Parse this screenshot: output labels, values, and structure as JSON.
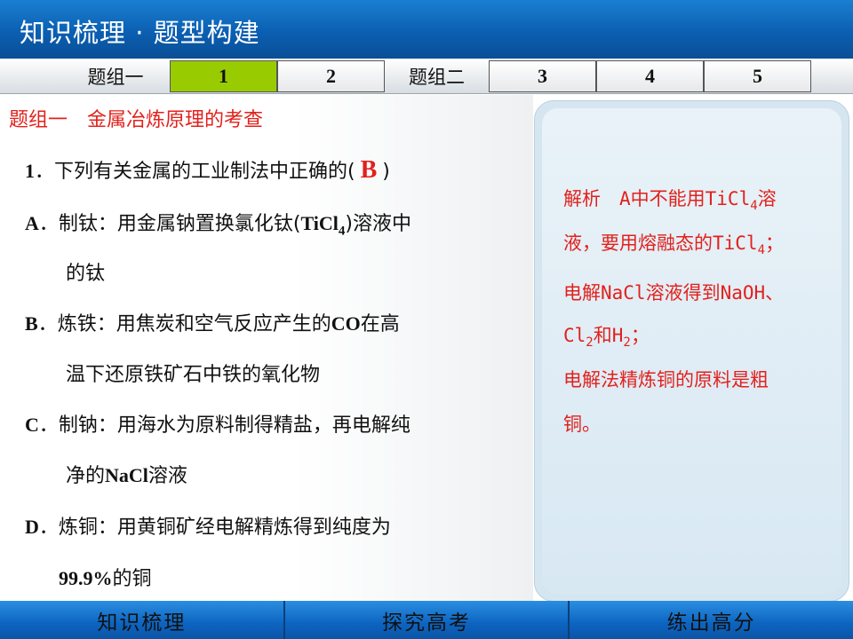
{
  "header": {
    "title": "知识梳理 · 题型构建"
  },
  "tabs": [
    {
      "label": "题组一",
      "kind": "group"
    },
    {
      "label": "1",
      "kind": "tab",
      "active": true
    },
    {
      "label": "2",
      "kind": "tab"
    },
    {
      "label": "题组二",
      "kind": "group"
    },
    {
      "label": "3",
      "kind": "tab"
    },
    {
      "label": "4",
      "kind": "tab"
    },
    {
      "label": "5",
      "kind": "tab"
    }
  ],
  "section": {
    "title": "题组一　金属冶炼原理的考查"
  },
  "question": {
    "stem_prefix": "1",
    "stem_text": "．下列有关金属的工业制法中正确的(",
    "answer": "B",
    "stem_close": ")",
    "options": {
      "A": {
        "letter": "A",
        "line1_a": "．制钛：用金属钠置换氯化钛(",
        "line1_b": "TiCl",
        "line1_sub": "4",
        "line1_c": ")溶液中",
        "line2": "的钛"
      },
      "B": {
        "letter": "B",
        "line1_a": "．炼铁：用焦炭和空气反应产生的",
        "line1_b": "CO",
        "line1_c": "在高",
        "line2": "温下还原铁矿石中铁的氧化物"
      },
      "C": {
        "letter": "C",
        "line1": "．制钠：用海水为原料制得精盐，再电解纯",
        "line2_a": "净的",
        "line2_b": "NaCl",
        "line2_c": "溶液"
      },
      "D": {
        "letter": "D",
        "line1": "．炼铜：用黄铜矿经电解精炼得到纯度为",
        "line2_a": "99.9%",
        "line2_b": "的铜"
      }
    }
  },
  "explanation": {
    "l1_a": "解析　A中不能用TiCl",
    "l1_sub": "4",
    "l1_b": "溶",
    "l2_a": "液，要用熔融态的TiCl",
    "l2_sub": "4",
    "l2_b": "；",
    "l3": "电解NaCl溶液得到NaOH、",
    "l4_a": "Cl",
    "l4_sub1": "2",
    "l4_b": "和H",
    "l4_sub2": "2",
    "l4_c": "；",
    "l5": "电解法精炼铜的原料是粗",
    "l6": "铜。"
  },
  "bottom_nav": [
    "知识梳理",
    "探究高考",
    "练出高分"
  ],
  "colors": {
    "accent_red": "#e2211c",
    "active_tab": "#99cc00",
    "header_blue": "#0b5fb2"
  }
}
